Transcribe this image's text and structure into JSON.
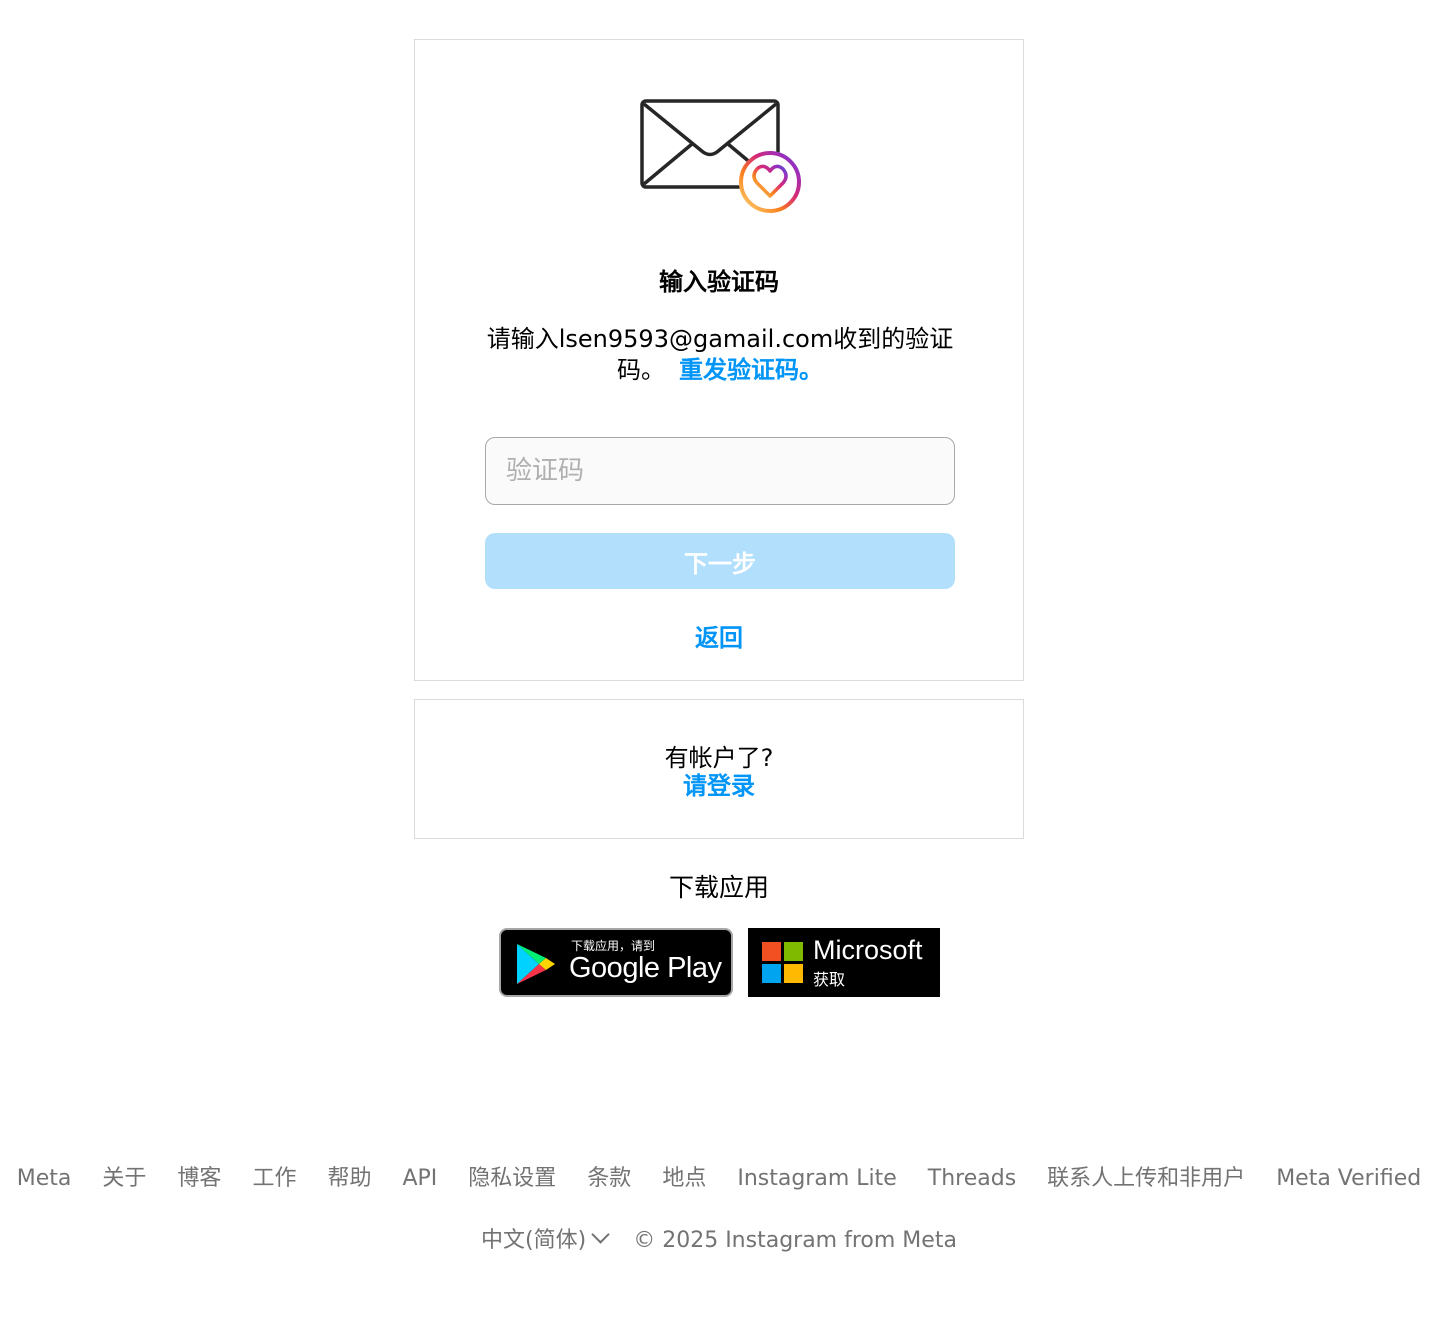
{
  "card": {
    "title": "输入验证码",
    "description": "请输入lsen9593@gamail.com收到的验证码。",
    "resend_link": "重发验证码。",
    "code_input": {
      "placeholder": "验证码",
      "value": ""
    },
    "next_button": "下一步",
    "back_link": "返回"
  },
  "login_card": {
    "prompt": "有帐户了?",
    "login_link": "请登录"
  },
  "download": {
    "title": "下载应用",
    "google_play": {
      "small": "下载应用，请到",
      "big": "Google Play"
    },
    "microsoft": {
      "big": "Microsoft",
      "small": "获取"
    }
  },
  "footer": {
    "links": [
      "Meta",
      "关于",
      "博客",
      "工作",
      "帮助",
      "API",
      "隐私设置",
      "条款",
      "地点",
      "Instagram Lite",
      "Threads",
      "联系人上传和非用户",
      "Meta Verified"
    ],
    "language": "中文(简体)",
    "copyright": "© 2025 Instagram from Meta"
  },
  "colors": {
    "accent": "#0095f6",
    "button_disabled": "#b2dffc",
    "border": "#dbdbdb",
    "footer_text": "#737373"
  },
  "icons": {
    "envelope": "envelope-heart-icon",
    "google_play": "google-play-icon",
    "microsoft": "microsoft-logo-icon",
    "language_chevron": "chevron-down-icon"
  }
}
